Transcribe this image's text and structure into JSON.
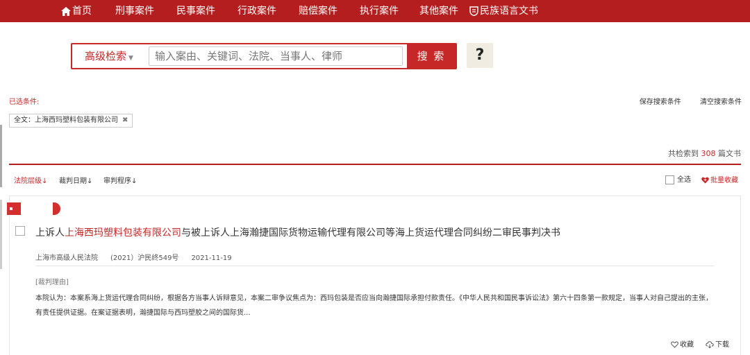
{
  "nav": {
    "home": "首页",
    "criminal": "刑事案件",
    "civil": "民事案件",
    "administrative": "行政案件",
    "compensation": "赔偿案件",
    "enforcement": "执行案件",
    "other": "其他案件",
    "ethnic": "民族语言文书"
  },
  "search": {
    "advanced_label": "高级检索",
    "placeholder": "输入案由、关键词、法院、当事人、律师",
    "value": "",
    "button": "搜 索",
    "help": "?"
  },
  "conditions": {
    "label": "已选条件:",
    "save": "保存搜索条件",
    "clear": "清空搜索条件",
    "chip": "全文：上海西玛塑料包装有限公司",
    "chip_remove": "✖"
  },
  "results": {
    "prefix": "共检索到 ",
    "count": "308",
    "suffix": " 篇文书"
  },
  "sort": {
    "court_level": "法院层级↓",
    "date": "裁判日期↓",
    "procedure": "审判程序↓",
    "select_all": "全选",
    "batch_fav": "批量收藏"
  },
  "case": {
    "title_pre": "上诉人",
    "title_hl": "上海西玛塑料包装有限公司",
    "title_post": "与被上诉人上海瀚捷国际货物运输代理有限公司等海上货运代理合同纠纷二审民事判决书",
    "court": "上海市高级人民法院",
    "number": "(2021）沪民终549号",
    "date": "2021-11-19",
    "reason_label": "[裁判理由]",
    "reason_text": "本院认为：本案系海上货运代理合同纠纷，根据各方当事人诉辩意见，本案二审争议焦点为：西玛包装是否应当向瀚捷国际承担付款责任。《中华人民共和国民事诉讼法》第六十四条第一款规定，当事人对自己提出的主张，有责任提供证据。在案证据表明，瀚捷国际与西玛塑胶之间的国际货...",
    "fav": "收藏",
    "download": "下载"
  },
  "colors": {
    "brand": "#b51e1e",
    "accent": "#c62828"
  }
}
